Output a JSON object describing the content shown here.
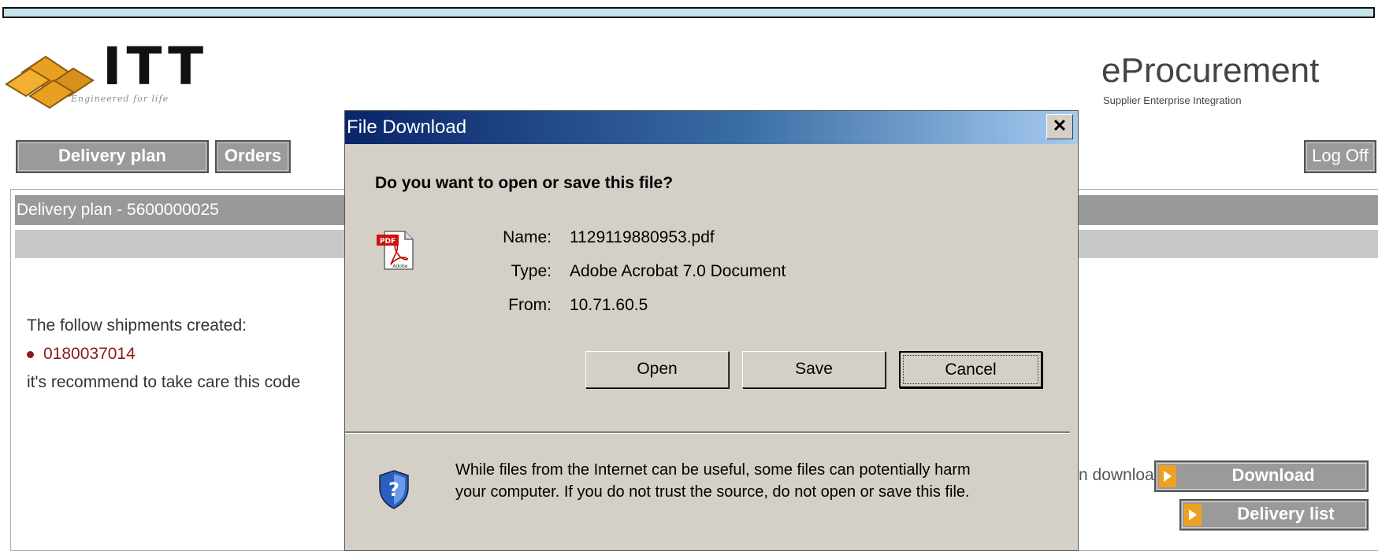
{
  "header": {
    "logo_text": "ITT",
    "logo_tagline": "Engineered for life",
    "app_title": "eProcurement",
    "app_subtitle": "Supplier Enterprise Integration"
  },
  "nav": {
    "delivery_plan": "Delivery plan",
    "orders": "Orders",
    "log_off": "Log Off"
  },
  "panel": {
    "title": "Delivery plan - 5600000025",
    "shipments_text": "The follow shipments created:",
    "shipment_number": "0180037014",
    "recommend_text": "it's recommend to take care this code",
    "download_hint": "n download",
    "download_button": "Download",
    "delivery_list_button": "Delivery list"
  },
  "dialog": {
    "title": "File Download",
    "close_symbol": "✕",
    "question": "Do you want to open or save this file?",
    "name_label": "Name:",
    "name_value": "1129119880953.pdf",
    "type_label": "Type:",
    "type_value": "Adobe Acrobat 7.0 Document",
    "from_label": "From:",
    "from_value": "10.71.60.5",
    "open_button": "Open",
    "save_button": "Save",
    "cancel_button": "Cancel",
    "warning_line1": "While files from the Internet can be useful, some files can potentially harm",
    "warning_line2": "your computer. If you do not trust the source, do not open or save this file.",
    "file_icon": "pdf-file-icon",
    "warning_icon": "shield-question-icon"
  },
  "colors": {
    "topbar": "#c3e3ea",
    "nav_button": "#9a9a9a",
    "accent_arrow": "#f0a020",
    "shipment_red": "#8b1a1a",
    "dialog_bg": "#d4d0c8",
    "title_gradient_start": "#0a246a",
    "title_gradient_end": "#a6caf0"
  }
}
